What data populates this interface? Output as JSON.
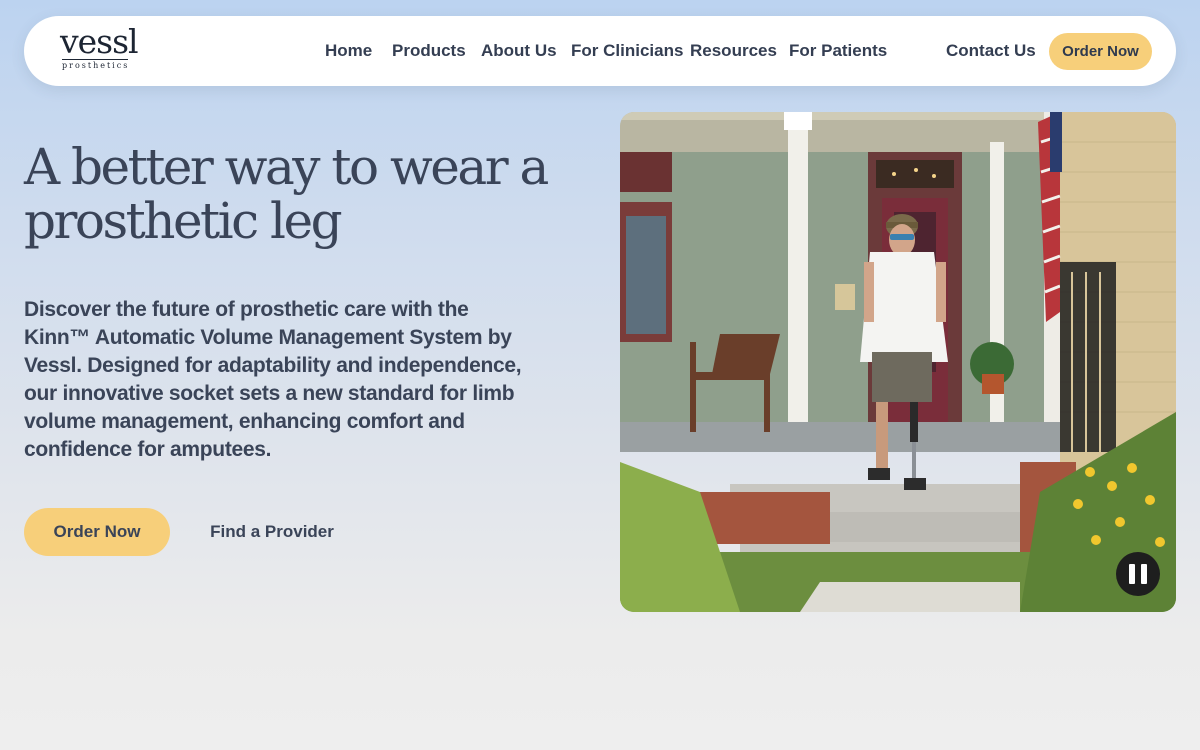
{
  "brand": {
    "name": "vessl",
    "tagline": "prosthetics"
  },
  "nav": {
    "items": [
      {
        "label": "Home"
      },
      {
        "label": "Products"
      },
      {
        "label": "About Us"
      },
      {
        "label": "For Clinicians"
      },
      {
        "label": "Resources"
      },
      {
        "label": "For Patients"
      }
    ],
    "contact_label": "Contact Us",
    "order_label": "Order Now"
  },
  "hero": {
    "title": "A better way to wear a prosthetic leg",
    "description": "Discover the future of prosthetic care with the Kinn™ Automatic Volume Management System by Vessl. Designed for adaptability and independence, our innovative socket sets a new standard for limb volume management, enhancing comfort and confidence for amputees.",
    "primary_cta": "Order Now",
    "secondary_cta": "Find a Provider"
  },
  "video": {
    "state": "playing",
    "control_icon": "pause-icon"
  },
  "colors": {
    "accent": "#f7cf7a",
    "text": "#3a4458",
    "background_top": "#bcd3f0",
    "background_bottom": "#eeeeee"
  }
}
